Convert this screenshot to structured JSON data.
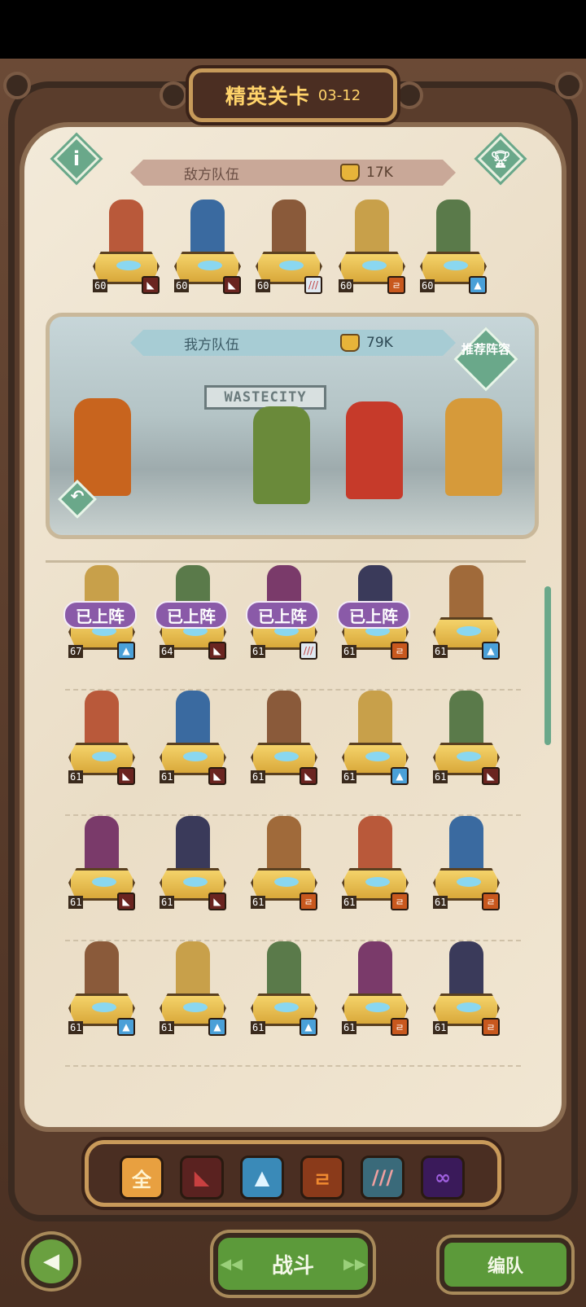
{
  "header": {
    "title": "精英关卡",
    "stage": "03-12"
  },
  "enemy_team": {
    "label": "敌方队伍",
    "power": "17K",
    "heroes": [
      {
        "level": "60",
        "faction": "red"
      },
      {
        "level": "60",
        "faction": "red"
      },
      {
        "level": "60",
        "faction": "wing"
      },
      {
        "level": "60",
        "faction": "orange"
      },
      {
        "level": "60",
        "faction": "blue"
      }
    ]
  },
  "ally_team": {
    "label": "我方队伍",
    "power": "79K",
    "recommend_label": "推荐阵容",
    "sign_text": "WASTECITY"
  },
  "deployed_label": "已上阵",
  "roster": [
    {
      "level": "67",
      "faction": "blue",
      "deployed": true
    },
    {
      "level": "64",
      "faction": "red",
      "deployed": true
    },
    {
      "level": "61",
      "faction": "wing",
      "deployed": true
    },
    {
      "level": "61",
      "faction": "orange",
      "deployed": true
    },
    {
      "level": "61",
      "faction": "blue",
      "deployed": false
    },
    {
      "level": "61",
      "faction": "red",
      "deployed": false
    },
    {
      "level": "61",
      "faction": "red",
      "deployed": false
    },
    {
      "level": "61",
      "faction": "red",
      "deployed": false
    },
    {
      "level": "61",
      "faction": "blue",
      "deployed": false
    },
    {
      "level": "61",
      "faction": "red",
      "deployed": false
    },
    {
      "level": "61",
      "faction": "red",
      "deployed": false
    },
    {
      "level": "61",
      "faction": "red",
      "deployed": false
    },
    {
      "level": "61",
      "faction": "orange",
      "deployed": false
    },
    {
      "level": "61",
      "faction": "orange",
      "deployed": false
    },
    {
      "level": "61",
      "faction": "orange",
      "deployed": false
    },
    {
      "level": "61",
      "faction": "blue",
      "deployed": false
    },
    {
      "level": "61",
      "faction": "blue",
      "deployed": false
    },
    {
      "level": "61",
      "faction": "blue",
      "deployed": false
    },
    {
      "level": "61",
      "faction": "orange",
      "deployed": false
    },
    {
      "level": "61",
      "faction": "orange",
      "deployed": false
    }
  ],
  "filters": [
    {
      "label": "全",
      "icon": "all-icon"
    },
    {
      "label": "",
      "icon": "red-faction-icon"
    },
    {
      "label": "",
      "icon": "wolf-faction-icon"
    },
    {
      "label": "",
      "icon": "orange-faction-icon"
    },
    {
      "label": "",
      "icon": "wing-faction-icon"
    },
    {
      "label": "",
      "icon": "infinity-faction-icon"
    }
  ],
  "bottom": {
    "battle_label": "战斗",
    "team_label": "编队"
  }
}
